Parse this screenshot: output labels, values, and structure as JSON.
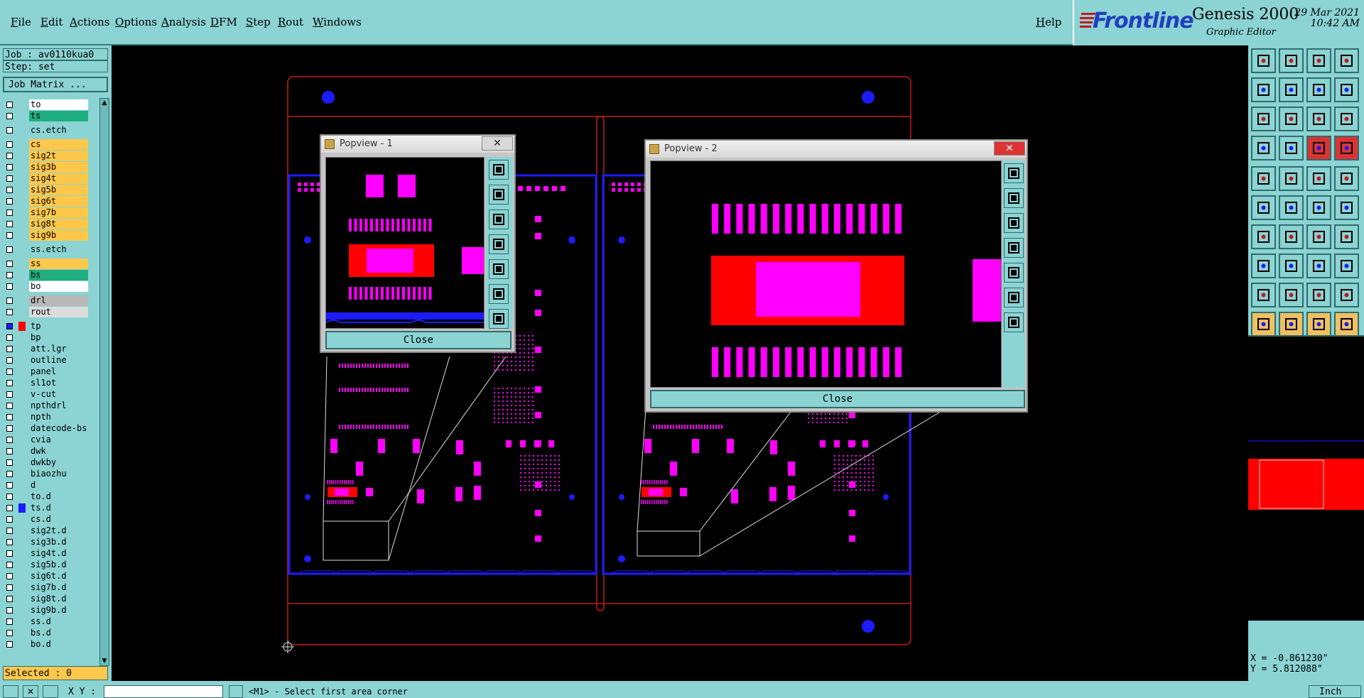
{
  "menu": {
    "items": [
      "File",
      "Edit",
      "Actions",
      "Options",
      "Analysis",
      "DFM",
      "Step",
      "Rout",
      "Windows"
    ],
    "help": "Help"
  },
  "brand": {
    "logo_text": "Frontline",
    "product": "Genesis 2000",
    "subtitle": "Graphic Editor",
    "date": "29 Mar 2021",
    "time": "10:42 AM"
  },
  "job": {
    "job_label": "Job : av0110kua0",
    "step_label": "Step: set",
    "matrix_button": "Job Matrix ..."
  },
  "layers": [
    {
      "name": "to",
      "color": "#ffffff",
      "gap": false
    },
    {
      "name": "ts",
      "color": "#1fae7f",
      "gap": false
    },
    {
      "name": "cs.etch",
      "color": "#8cd3d3",
      "gap": true
    },
    {
      "name": "cs",
      "color": "#ffc84a",
      "gap": true
    },
    {
      "name": "sig2t",
      "color": "#ffc84a",
      "gap": false
    },
    {
      "name": "sig3b",
      "color": "#ffc84a",
      "gap": false
    },
    {
      "name": "sig4t",
      "color": "#ffc84a",
      "gap": false
    },
    {
      "name": "sig5b",
      "color": "#ffc84a",
      "gap": false
    },
    {
      "name": "sig6t",
      "color": "#ffc84a",
      "gap": false
    },
    {
      "name": "sig7b",
      "color": "#ffc84a",
      "gap": false
    },
    {
      "name": "sig8t",
      "color": "#ffc84a",
      "gap": false
    },
    {
      "name": "sig9b",
      "color": "#ffc84a",
      "gap": false
    },
    {
      "name": "ss.etch",
      "color": "#8cd3d3",
      "gap": true
    },
    {
      "name": "ss",
      "color": "#ffc84a",
      "gap": true
    },
    {
      "name": "bs",
      "color": "#1fae7f",
      "gap": false
    },
    {
      "name": "bo",
      "color": "#ffffff",
      "gap": false
    },
    {
      "name": "drl",
      "color": "#b8b8b8",
      "gap": true
    },
    {
      "name": "rout",
      "color": "#dcdcdc",
      "gap": false
    },
    {
      "name": "tp",
      "color": "#8cd3d3",
      "gap": true
    },
    {
      "name": "bp",
      "color": "#8cd3d3",
      "gap": false
    },
    {
      "name": "att.lgr",
      "color": "#8cd3d3",
      "gap": false
    },
    {
      "name": "outline",
      "color": "#8cd3d3",
      "gap": false
    },
    {
      "name": "panel",
      "color": "#8cd3d3",
      "gap": false
    },
    {
      "name": "sl1ot",
      "color": "#8cd3d3",
      "gap": false
    },
    {
      "name": "v-cut",
      "color": "#8cd3d3",
      "gap": false
    },
    {
      "name": "npthdrl",
      "color": "#8cd3d3",
      "gap": false
    },
    {
      "name": "npth",
      "color": "#8cd3d3",
      "gap": false
    },
    {
      "name": "datecode-bs",
      "color": "#8cd3d3",
      "gap": false
    },
    {
      "name": "cvia",
      "color": "#8cd3d3",
      "gap": false
    },
    {
      "name": "dwk",
      "color": "#8cd3d3",
      "gap": false
    },
    {
      "name": "dwkby",
      "color": "#8cd3d3",
      "gap": false
    },
    {
      "name": "biaozhu",
      "color": "#8cd3d3",
      "gap": false
    },
    {
      "name": "d",
      "color": "#8cd3d3",
      "gap": false
    },
    {
      "name": "to.d",
      "color": "#8cd3d3",
      "gap": false
    },
    {
      "name": "ts.d",
      "color": "#8cd3d3",
      "gap": false
    },
    {
      "name": "cs.d",
      "color": "#8cd3d3",
      "gap": false
    },
    {
      "name": "sig2t.d",
      "color": "#8cd3d3",
      "gap": false
    },
    {
      "name": "sig3b.d",
      "color": "#8cd3d3",
      "gap": false
    },
    {
      "name": "sig4t.d",
      "color": "#8cd3d3",
      "gap": false
    },
    {
      "name": "sig5b.d",
      "color": "#8cd3d3",
      "gap": false
    },
    {
      "name": "sig6t.d",
      "color": "#8cd3d3",
      "gap": false
    },
    {
      "name": "sig7b.d",
      "color": "#8cd3d3",
      "gap": false
    },
    {
      "name": "sig8t.d",
      "color": "#8cd3d3",
      "gap": false
    },
    {
      "name": "sig9b.d",
      "color": "#8cd3d3",
      "gap": false
    },
    {
      "name": "ss.d",
      "color": "#8cd3d3",
      "gap": false
    },
    {
      "name": "bs.d",
      "color": "#8cd3d3",
      "gap": false
    },
    {
      "name": "bo.d",
      "color": "#8cd3d3",
      "gap": false
    }
  ],
  "selected_label": "Selected : 0",
  "popview1": {
    "title": "Popview - 1",
    "close": "Close"
  },
  "popview2": {
    "title": "Popview - 2",
    "close": "Close"
  },
  "coords": {
    "x": "X = -0.861230\"",
    "y": "Y = 5.812088\""
  },
  "status": {
    "xy_label": "X Y :",
    "message": "<M1> - Select first area corner",
    "units": "Inch"
  },
  "colors": {
    "panel_bg": "#8cd3d3",
    "pad": "#ff00ff",
    "copper": "#ff0000",
    "board_outline": "#1c1cff",
    "rout_line": "#c41a1a",
    "active_layer": "#ffc84a",
    "work_layer": "#1fae7f"
  }
}
